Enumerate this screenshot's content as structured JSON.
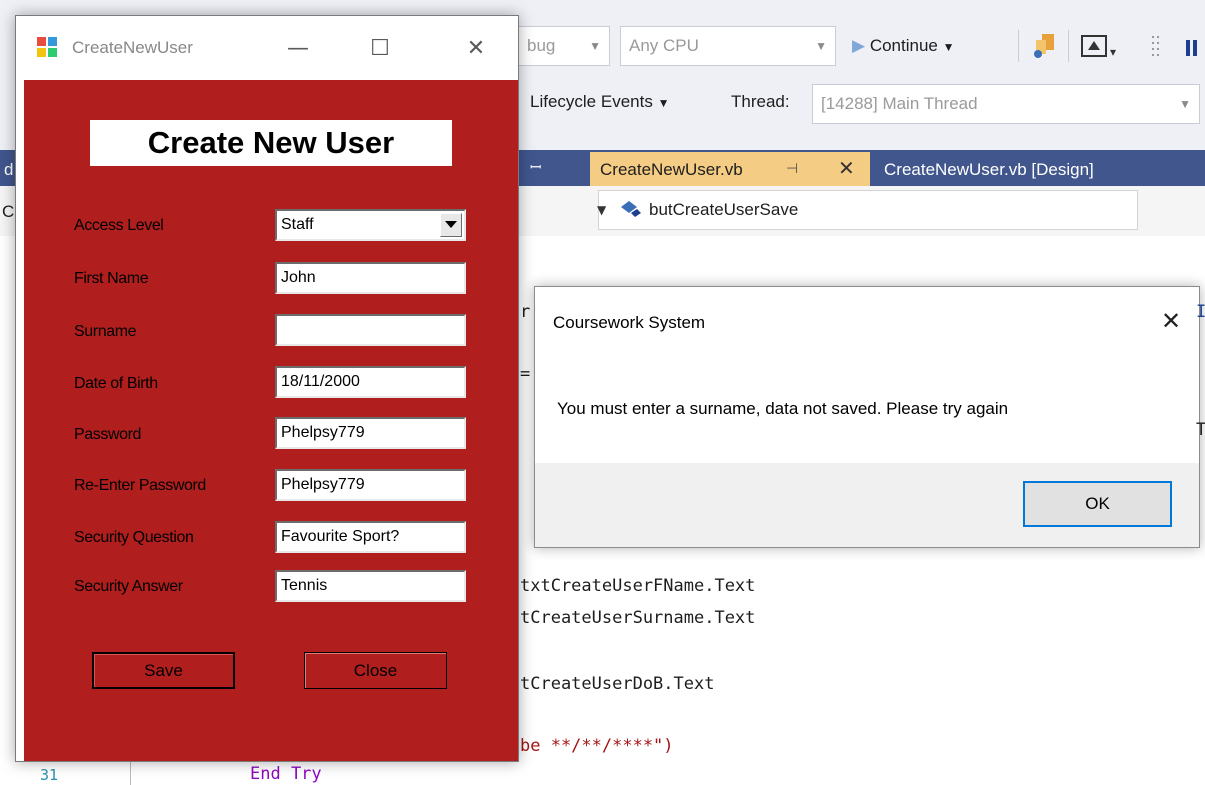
{
  "ide": {
    "config_fragment": "bug",
    "platform_combo": "Any CPU",
    "continue_label": "Continue",
    "lifecycle_label": "Lifecycle Events",
    "thread_label": "Thread:",
    "thread_value": "[14288] Main Thread",
    "pin_glyph": "ꟷ",
    "tab_active_label": "CreateNewUser.vb",
    "tab_design_label": "CreateNewUser.vb [Design]",
    "method_combo": "butCreateUserSave",
    "code_lines": [
      "txtCreateUserFName.Text",
      "tCreateUserSurname.Text",
      "tCreateUserDoB.Text"
    ],
    "code_string_line": "be **/**/****\")",
    "end_try": "End Try",
    "line_number": "31",
    "left_fragments": [
      "d",
      "C"
    ],
    "partial_r": "r",
    "partial_eq": "="
  },
  "window": {
    "title": "CreateNewUser",
    "heading": "Create New User",
    "fields": {
      "access_level": {
        "label": "Access Level",
        "value": "Staff"
      },
      "first_name": {
        "label": "First Name",
        "value": "John"
      },
      "surname": {
        "label": "Surname",
        "value": ""
      },
      "dob": {
        "label": "Date of Birth",
        "value": "18/11/2000"
      },
      "password": {
        "label": "Password",
        "value": "Phelpsy779"
      },
      "reenter_password": {
        "label": "Re-Enter Password",
        "value": "Phelpsy779"
      },
      "security_question": {
        "label": "Security Question",
        "value": "Favourite Sport?"
      },
      "security_answer": {
        "label": "Security Answer",
        "value": "Tennis"
      }
    },
    "save_label": "Save",
    "close_label": "Close",
    "colors": {
      "form_bg": "#b01e1e"
    }
  },
  "messagebox": {
    "title": "Coursework System",
    "message": "You must enter a surname, data not saved. Please try again",
    "ok_label": "OK"
  }
}
